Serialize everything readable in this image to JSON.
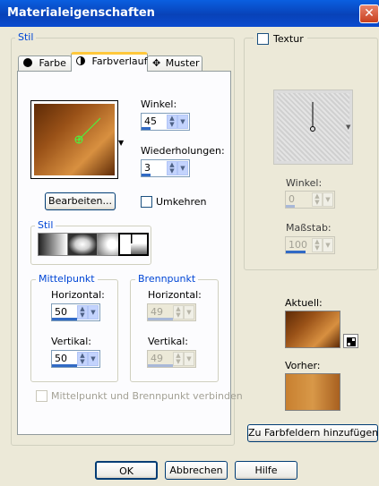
{
  "window": {
    "title": "Materialeigenschaften",
    "close": "✕"
  },
  "stil_group": {
    "label": "Stil"
  },
  "tabs": [
    {
      "label": "Farbe"
    },
    {
      "label": "Farbverlauf"
    },
    {
      "label": "Muster"
    }
  ],
  "winkel": {
    "label": "Winkel:",
    "value": "45"
  },
  "wiederholungen": {
    "label": "Wiederholungen:",
    "value": "3"
  },
  "bearbeiten": {
    "label": "Bearbeiten..."
  },
  "umkehren": {
    "label": "Umkehren",
    "checked": false
  },
  "stil_sub": {
    "label": "Stil"
  },
  "mittelpunkt": {
    "label": "Mittelpunkt",
    "horizontal_label": "Horizontal:",
    "horizontal_value": "50",
    "vertikal_label": "Vertikal:",
    "vertikal_value": "50"
  },
  "brennpunkt": {
    "label": "Brennpunkt",
    "horizontal_label": "Horizontal:",
    "horizontal_value": "49",
    "vertikal_label": "Vertikal:",
    "vertikal_value": "49"
  },
  "verbinden": {
    "label": "Mittelpunkt und Brennpunkt verbinden"
  },
  "textur": {
    "label": "Textur",
    "winkel_label": "Winkel:",
    "winkel_value": "0",
    "massstab_label": "Maßstab:",
    "massstab_value": "100"
  },
  "aktuell": {
    "label": "Aktuell:"
  },
  "vorher": {
    "label": "Vorher:"
  },
  "add_button": {
    "label": "Zu Farbfeldern hinzufügen..."
  },
  "footer": {
    "ok": "OK",
    "cancel": "Abbrechen",
    "help": "Hilfe"
  },
  "colors": {
    "gradient_dark": "#5e2a06",
    "gradient_light": "#d89040",
    "accent": "#316ac5"
  }
}
